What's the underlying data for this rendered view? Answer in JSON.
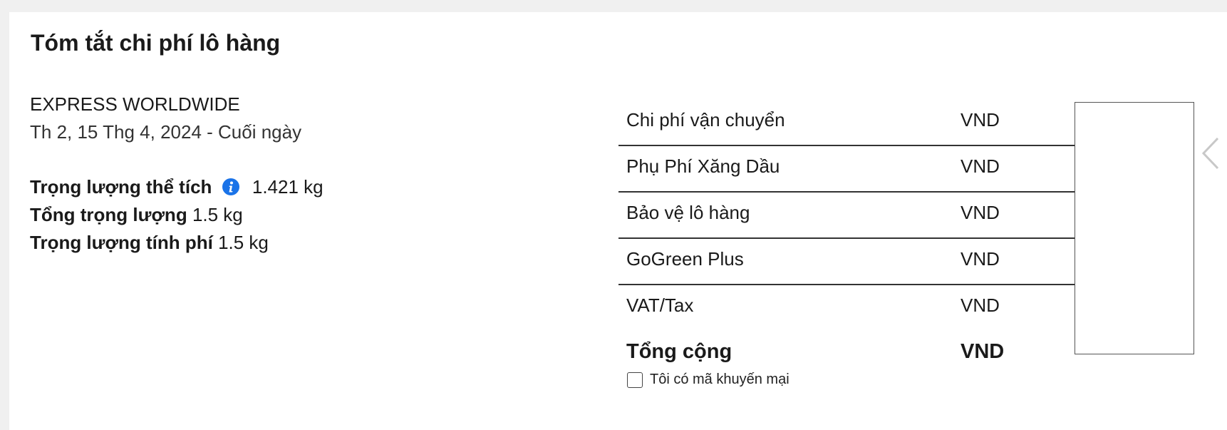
{
  "summary": {
    "title": "Tóm tắt chi phí lô hàng",
    "service_name": "EXPRESS WORLDWIDE",
    "delivery_date": "Th 2, 15 Thg 4, 2024 - Cuối ngày",
    "weights": [
      {
        "label": "Trọng lượng thể tích",
        "value": "1.421 kg",
        "has_info_icon": true
      },
      {
        "label": "Tổng trọng lượng",
        "value": "1.5 kg",
        "has_info_icon": false
      },
      {
        "label": "Trọng lượng tính phí",
        "value": "1.5 kg",
        "has_info_icon": false
      }
    ]
  },
  "costs": {
    "rows": [
      {
        "label": "Chi phí vận chuyển",
        "currency": "VND"
      },
      {
        "label": "Phụ Phí Xăng Dầu",
        "currency": "VND"
      },
      {
        "label": "Bảo vệ lô hàng",
        "currency": "VND"
      },
      {
        "label": "GoGreen Plus",
        "currency": "VND"
      },
      {
        "label": "VAT/Tax",
        "currency": "VND"
      }
    ],
    "total": {
      "label": "Tổng cộng",
      "currency": "VND"
    }
  },
  "promo": {
    "label": "Tôi có mã khuyến mại",
    "checked": false
  },
  "icons": {
    "info": "info-icon",
    "chevron": "chevron-left-icon"
  },
  "colors": {
    "info_icon": "#1a73e8",
    "background": "#f0f0f0",
    "card": "#ffffff"
  }
}
